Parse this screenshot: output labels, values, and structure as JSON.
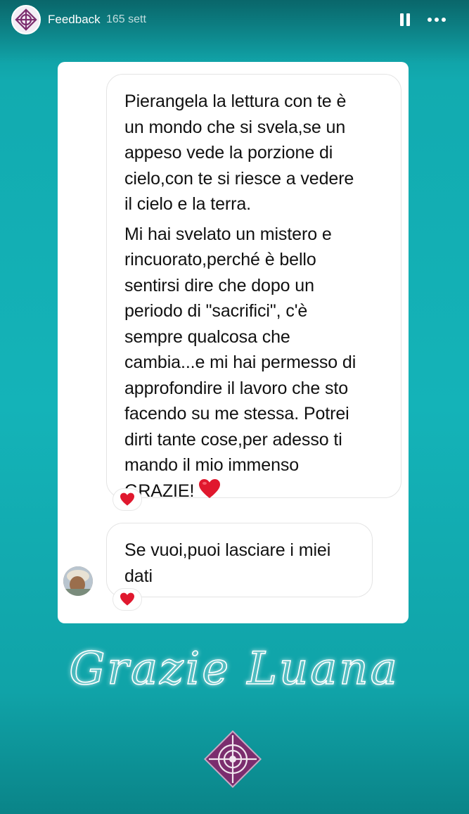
{
  "header": {
    "username": "Feedback",
    "timestamp": "165 sett",
    "profile_icon": "mandala-logo-icon",
    "pause_icon": "pause-icon",
    "more_icon": "more-dots-icon"
  },
  "messages": [
    {
      "paragraphs": [
        "Pierangela la lettura con te è\nun mondo che si svela,se un\nappeso vede la porzione di\ncielo,con te si riesce a vedere\nil cielo e la terra.",
        "Mi hai svelato un mistero e\nrincuorato,perché è bello\nsentirsi dire che dopo un\nperiodo di \"sacrifici\", c'è\nsempre qualcosa che\ncambia...e mi hai permesso di\napprofondire il lavoro che sto\nfacendo su me stessa. Potrei\ndirti tante cose,per adesso ti\nmando il mio immenso\nGRAZIE!"
      ],
      "reaction": "heart-icon"
    },
    {
      "paragraphs": [
        "Se vuoi,puoi lasciare i miei\ndati"
      ],
      "reaction": "heart-icon"
    }
  ],
  "caption": "Grazie Luana",
  "colors": {
    "background": "#12abb0",
    "heart": "#e0182e",
    "logo": "#7b2d6e"
  }
}
